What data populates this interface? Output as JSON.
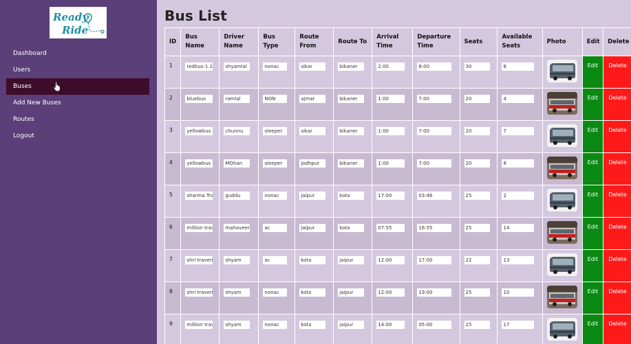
{
  "logo": {
    "line1": "Ready",
    "line2": "Ride"
  },
  "sidebar": {
    "items": [
      {
        "label": "Dashboard"
      },
      {
        "label": "Users"
      },
      {
        "label": "Buses"
      },
      {
        "label": "Add New Buses"
      },
      {
        "label": "Routes"
      },
      {
        "label": "Logout"
      }
    ]
  },
  "page": {
    "title": "Bus List"
  },
  "table": {
    "headers": {
      "id": "ID",
      "bus_name": "Bus Name",
      "driver_name": "Driver Name",
      "bus_type": "Bus Type",
      "route_from": "Route From",
      "route_to": "Route To",
      "arrival": "Arrival Time",
      "departure": "Departure Time",
      "seats": "Seats",
      "available": "Available Seats",
      "photo": "Photo",
      "edit": "Edit",
      "delete": "Delete"
    },
    "rows": [
      {
        "id": "1",
        "bus_name": "redbus-1.1",
        "driver_name": "shyamlal",
        "bus_type": "nonac",
        "route_from": "sikar",
        "route_to": "bikaner",
        "arrival": "2:00",
        "departure": "8:00",
        "seats": "30",
        "available": "8",
        "photo": "bus-photo-grey",
        "edit": "Edit",
        "delete": "Delete"
      },
      {
        "id": "2",
        "bus_name": "bluebus",
        "driver_name": "ramlal",
        "bus_type": "NON",
        "route_from": "ajmar",
        "route_to": "bikaner",
        "arrival": "1:00",
        "departure": "7:00",
        "seats": "20",
        "available": "4",
        "photo": "bus-photo-red",
        "edit": "Edit",
        "delete": "Delete"
      },
      {
        "id": "3",
        "bus_name": "yellowbus",
        "driver_name": "chunnu",
        "bus_type": "sleeper",
        "route_from": "sikar",
        "route_to": "bikaner",
        "arrival": "1:00",
        "departure": "7:00",
        "seats": "20",
        "available": "7",
        "photo": "bus-photo-grey",
        "edit": "Edit",
        "delete": "Delete"
      },
      {
        "id": "4",
        "bus_name": "yellowbus",
        "driver_name": "MOhan",
        "bus_type": "sleeper",
        "route_from": "jodhpur",
        "route_to": "bikaner",
        "arrival": "1:00",
        "departure": "7:00",
        "seats": "20",
        "available": "8",
        "photo": "bus-photo-red",
        "edit": "Edit",
        "delete": "Delete"
      },
      {
        "id": "5",
        "bus_name": "sharma Tra",
        "driver_name": "guddu",
        "bus_type": "nonac",
        "route_from": "jaipur",
        "route_to": "kota",
        "arrival": "17:00",
        "departure": "03:46",
        "seats": "25",
        "available": "2",
        "photo": "bus-photo-grey",
        "edit": "Edit",
        "delete": "Delete"
      },
      {
        "id": "6",
        "bus_name": "million trav",
        "driver_name": "mahaveer",
        "bus_type": "ac",
        "route_from": "jaipur",
        "route_to": "kota",
        "arrival": "07:55",
        "departure": "16:55",
        "seats": "25",
        "available": "14",
        "photo": "bus-photo-red",
        "edit": "Edit",
        "delete": "Delete"
      },
      {
        "id": "7",
        "bus_name": "shri traveri",
        "driver_name": "shyam",
        "bus_type": "ac",
        "route_from": "kota",
        "route_to": "jaipur",
        "arrival": "12:00",
        "departure": "17:00",
        "seats": "22",
        "available": "13",
        "photo": "bus-photo-grey",
        "edit": "Edit",
        "delete": "Delete"
      },
      {
        "id": "8",
        "bus_name": "shri traveri",
        "driver_name": "shyam",
        "bus_type": "nonac",
        "route_from": "kota",
        "route_to": "jaipur",
        "arrival": "12:00",
        "departure": "19:00",
        "seats": "25",
        "available": "10",
        "photo": "bus-photo-red",
        "edit": "Edit",
        "delete": "Delete"
      },
      {
        "id": "9",
        "bus_name": "million trav",
        "driver_name": "shyam",
        "bus_type": "nonac",
        "route_from": "kota",
        "route_to": "jaipur",
        "arrival": "14:00",
        "departure": "05:00",
        "seats": "25",
        "available": "17",
        "photo": "bus-photo-grey",
        "edit": "Edit",
        "delete": "Delete"
      }
    ]
  },
  "colors": {
    "sidebar_bg": "#5b3f78",
    "active_item_bg": "#3f0c2c",
    "page_bg": "#d4c8de",
    "row_alt_bg": "#c7bad1",
    "edit_button": "#0a8a12",
    "delete_button": "#ff1a1a",
    "logo_teal": "#1f8fa3"
  }
}
